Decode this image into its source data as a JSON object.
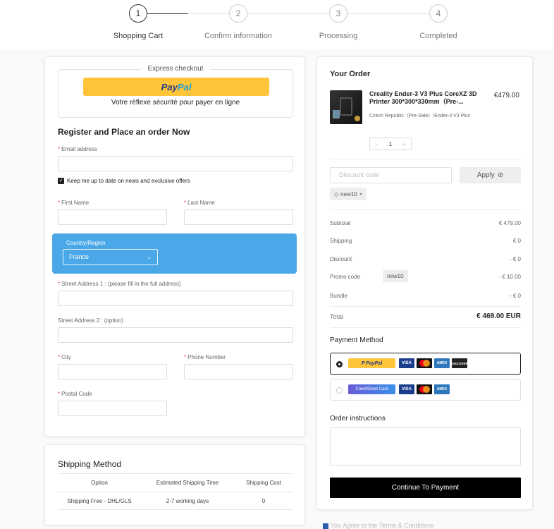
{
  "steps": [
    {
      "number": "1",
      "label": "Shopping Cart"
    },
    {
      "number": "2",
      "label": "Confirm information"
    },
    {
      "number": "3",
      "label": "Processing"
    },
    {
      "number": "4",
      "label": "Completed"
    }
  ],
  "express": {
    "title": "Express checkout",
    "paypal_pay": "Pay",
    "paypal_pal": "Pal",
    "tagline": "Votre réflexe sécurité pour payer en ligne"
  },
  "form": {
    "title": "Register and Place an order Now",
    "email_label": "Email address",
    "newsletter_label": "Keep me up to date on news and exclusive offers",
    "first_name_label": "First Name",
    "last_name_label": "Last Name",
    "country_label": "Country/Region",
    "country_value": "France",
    "street1_label": "Street Address 1 : (please fill in the full address)",
    "street2_label": "Street Address 2 : (option)",
    "city_label": "City",
    "phone_label": "Phone Number",
    "postal_label": "Postal Code",
    "required_mark": "*"
  },
  "shipping": {
    "title": "Shipping Method",
    "headers": [
      "Option",
      "Estimated Shipping Time",
      "Shipping Cost"
    ],
    "row": [
      "Shipping Free - DHL/GLS",
      "2-7 working days",
      "0"
    ]
  },
  "order": {
    "title": "Your Order",
    "product_title": "Creality Ender-3 V3 Plus CoreXZ 3D Printer 300*300*330mm（Pre-...",
    "product_price": "€479.00",
    "product_variant": "Czech Republic（Pre-Sale）/Ender-3 V3 Plus",
    "qty": "1",
    "qty_minus": "−",
    "qty_plus": "+",
    "discount_placeholder": "Discount code",
    "apply_label": "Apply",
    "applied_tag": "new10",
    "tag_remove": "×",
    "summary": {
      "subtotal_label": "Subtotal",
      "subtotal": "€ 479.00",
      "shipping_label": "Shipping",
      "shipping": "€ 0",
      "discount_label": "Discount",
      "discount": "- € 0",
      "promo_label": "Promo code",
      "promo_code": "new10",
      "promo": "- € 10.00",
      "bundle_label": "Bundle",
      "bundle": "- € 0",
      "total_label": "Total",
      "total": "€ 469.00 EUR"
    },
    "payment_title": "Payment Method",
    "paypal_mini": "P PayPal",
    "card_label": "Credit/Debit Card",
    "brands": {
      "visa": "VISA",
      "amex": "AMEX",
      "discover": "DISCOVER"
    },
    "instructions_title": "Order instructions",
    "continue_label": "Continue To Payment",
    "terms": "You Agree to the Terms & Conditions"
  },
  "icons": {
    "apply": "⊘",
    "tag": "◇",
    "chevron": "⌄"
  }
}
